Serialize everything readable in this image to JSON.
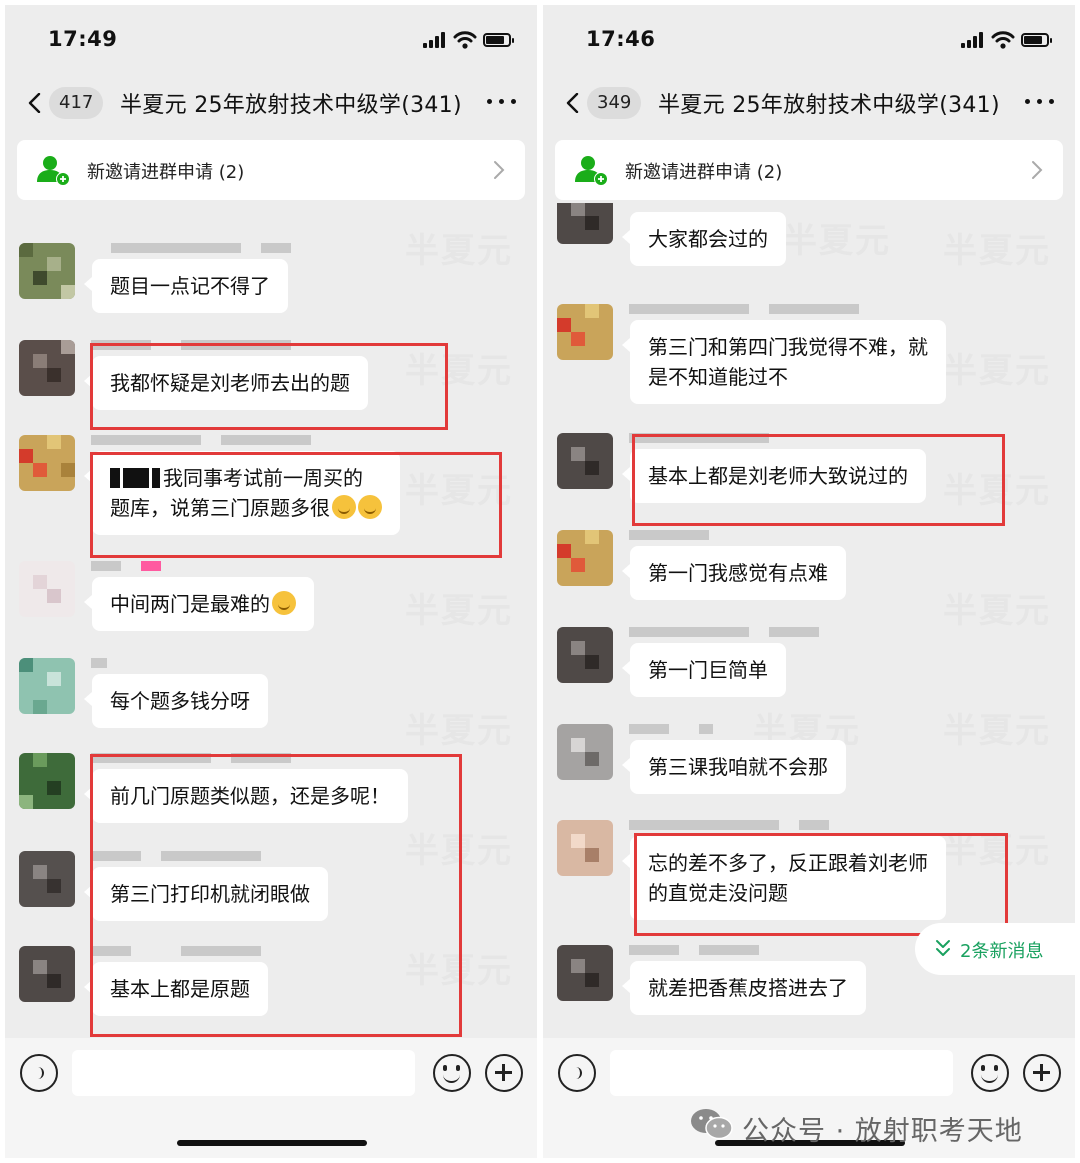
{
  "colors": {
    "accent_green": "#19a15f",
    "highlight_red": "#e23a3a",
    "chat_bg": "#ededed",
    "bubble_bg": "#ffffff"
  },
  "watermark_text": "半夏元",
  "left_phone": {
    "time": "17:49",
    "back_count": "417",
    "group_title": "半夏元 25年放射技术中级学(341)",
    "invite_banner": "新邀请进群申请 (2)",
    "messages": [
      {
        "text": "题目一点记不得了"
      },
      {
        "text": "我都怀疑是刘老师去出的题"
      },
      {
        "text_line1": "我同事考试前一周买的",
        "text_line2": "题库，说第三门原题多很"
      },
      {
        "text": "中间两门是最难的"
      },
      {
        "text": "每个题多钱分呀"
      },
      {
        "text": "前几门原题类似题，还是多呢！"
      },
      {
        "text": "第三门打印机就闭眼做"
      },
      {
        "text": "基本上都是原题"
      }
    ]
  },
  "right_phone": {
    "time": "17:46",
    "back_count": "349",
    "group_title": "半夏元 25年放射技术中级学(341)",
    "invite_banner": "新邀请进群申请 (2)",
    "messages": [
      {
        "text": "大家都会过的"
      },
      {
        "text_line1": "第三门和第四门我觉得不难，就",
        "text_line2": "是不知道能过不"
      },
      {
        "text": "基本上都是刘老师大致说过的"
      },
      {
        "text": "第一门我感觉有点难"
      },
      {
        "text": "第一门巨简单"
      },
      {
        "text": "第三课我咱就不会那"
      },
      {
        "text_line1": "忘的差不多了，反正跟着刘老师",
        "text_line2": "的直觉走没问题"
      },
      {
        "text": "就差把香蕉皮搭进去了"
      }
    ],
    "new_messages": "2条新消息"
  },
  "footer": {
    "text": "公众号 · 放射职考天地"
  }
}
